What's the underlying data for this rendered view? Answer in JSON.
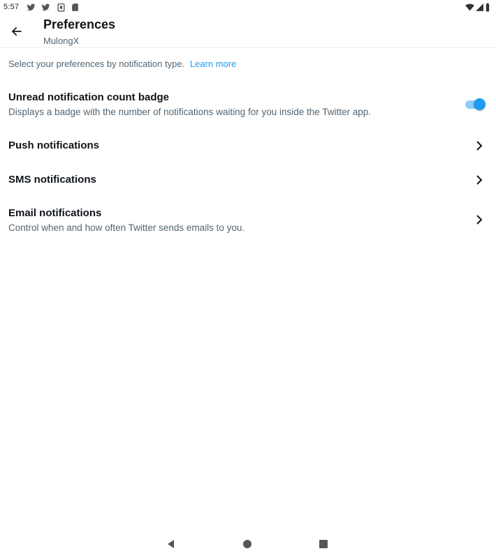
{
  "status_bar": {
    "time": "5:57",
    "notification_icons": [
      "twitter-icon",
      "twitter-icon",
      "clipboard-icon",
      "sd-card-icon"
    ],
    "system_icons": [
      "wifi-icon",
      "signal-icon",
      "battery-icon"
    ]
  },
  "header": {
    "title": "Preferences",
    "subtitle": "MulongX",
    "back_icon": "arrow-left-icon"
  },
  "intro": {
    "text": "Select your preferences by notification type.",
    "link": "Learn more"
  },
  "settings": {
    "unread_badge": {
      "title": "Unread notification count badge",
      "description": "Displays a badge with the number of notifications waiting for you inside the Twitter app.",
      "enabled": true
    },
    "push": {
      "title": "Push notifications"
    },
    "sms": {
      "title": "SMS notifications"
    },
    "email": {
      "title": "Email notifications",
      "description": "Control when and how often Twitter sends emails to you."
    }
  },
  "nav_bar": {
    "icons": [
      "back-icon",
      "home-icon",
      "recents-icon"
    ]
  },
  "colors": {
    "accent": "#1d9bf0",
    "text_primary": "#0f1419",
    "text_secondary": "#536471"
  }
}
